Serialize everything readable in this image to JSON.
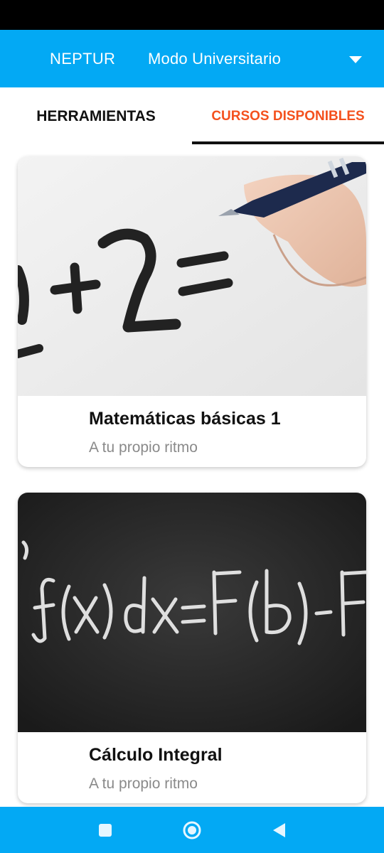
{
  "app_bar": {
    "title": "NEPTUR",
    "mode_selector": {
      "selected": "Modo Universitario",
      "icon": "triangle-down-icon"
    }
  },
  "tabs": [
    {
      "label": "HERRAMIENTAS",
      "selected": false
    },
    {
      "label": "CURSOS DISPONIBLES",
      "selected": true
    }
  ],
  "colors": {
    "primary": "#03a9f4",
    "accent": "#f4511e",
    "status_bar": "#000000"
  },
  "courses": [
    {
      "title": "Matemáticas básicas 1",
      "subtitle": "A tu propio ritmo",
      "image": "hand-writing-2+2-equation"
    },
    {
      "title": "Cálculo Integral",
      "subtitle": "A tu propio ritmo",
      "image": "chalkboard-integral-formula"
    }
  ],
  "nav": {
    "recents": "square-icon",
    "home": "circle-icon",
    "back": "triangle-left-icon"
  }
}
